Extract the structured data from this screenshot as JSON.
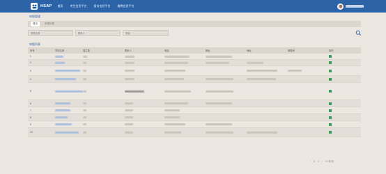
{
  "header": {
    "brand": "HSAP",
    "nav": [
      {
        "label": "首页"
      },
      {
        "label": "考生信息平台"
      },
      {
        "label": "报名信息平台"
      },
      {
        "label": "缴费信息平台"
      }
    ]
  },
  "page": {
    "section_title": "申报管理",
    "breadcrumb": [
      {
        "label": "首页"
      },
      {
        "label": "申报列表"
      }
    ],
    "search": {
      "field1_placeholder": "学校名称",
      "field2_placeholder": "联系人",
      "field3_placeholder": "电话"
    },
    "list_title": "申报列表"
  },
  "table": {
    "columns": [
      "序号",
      "学校名称",
      "招生数",
      "联系人",
      "电话",
      "网址",
      "地址",
      "邮箱号",
      "操作"
    ],
    "rows": [
      {
        "index": "1"
      },
      {
        "index": "2"
      },
      {
        "index": "3"
      },
      {
        "index": "4"
      },
      {
        "index": "5"
      },
      {
        "index": "6"
      },
      {
        "index": "7"
      },
      {
        "index": "8"
      },
      {
        "index": "9"
      },
      {
        "index": "10"
      }
    ]
  },
  "pager": {
    "prev": "‹",
    "pages": [
      "1",
      "2"
    ],
    "next": "›",
    "page_size": "10 条/页"
  },
  "colors": {
    "header_bg": "#2c63a6",
    "link": "#2c63a6",
    "page_bg": "#ece7e1",
    "edit_icon": "#35a05a"
  }
}
